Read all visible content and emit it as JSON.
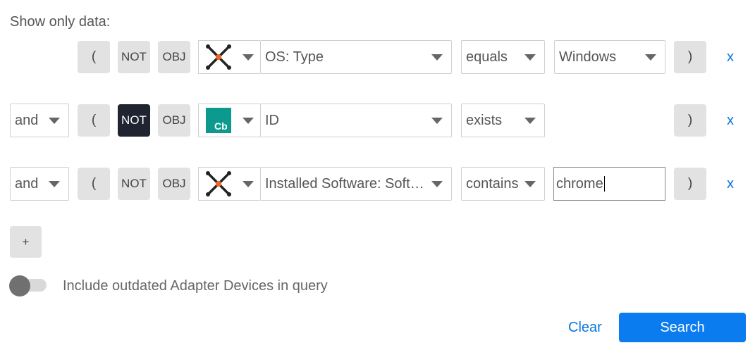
{
  "heading": "Show only data:",
  "rows": [
    {
      "conjunction": "",
      "open_paren": "(",
      "not_label": "NOT",
      "not_active": false,
      "obj_label": "OBJ",
      "adapter_icon": "cross-adapter-icon",
      "field": "OS: Type",
      "operator": "equals",
      "value": "Windows",
      "value_kind": "select",
      "close_paren": ")",
      "remove": "x"
    },
    {
      "conjunction": "and",
      "open_paren": "(",
      "not_label": "NOT",
      "not_active": true,
      "obj_label": "OBJ",
      "adapter_icon": "carbonblack-adapter-icon",
      "adapter_logo_text": "Cb",
      "field": "ID",
      "operator": "exists",
      "value": "",
      "value_kind": "none",
      "close_paren": ")",
      "remove": "x"
    },
    {
      "conjunction": "and",
      "open_paren": "(",
      "not_label": "NOT",
      "not_active": false,
      "obj_label": "OBJ",
      "adapter_icon": "cross-adapter-icon",
      "field": "Installed Software: Software Name",
      "operator": "contains",
      "value": "chrome",
      "value_kind": "input",
      "close_paren": ")",
      "remove": "x"
    }
  ],
  "add_label": "+",
  "toggle": {
    "label": "Include outdated Adapter Devices in query",
    "on": false
  },
  "actions": {
    "clear": "Clear",
    "search": "Search"
  },
  "colors": {
    "accent": "#0b7cf0",
    "link": "#0b76e0",
    "not_active": "#1f2430",
    "cb_logo": "#0c9a8e",
    "adapter_dot": "#f26522"
  }
}
